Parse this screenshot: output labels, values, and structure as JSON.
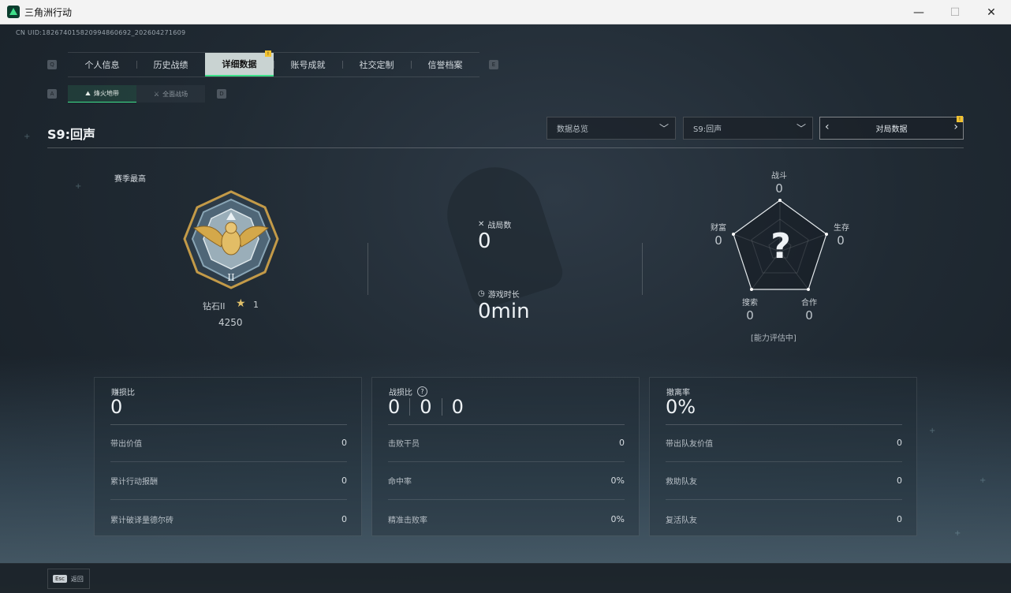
{
  "window": {
    "title": "三角洲行动",
    "minimize": "—",
    "maximize": "☐",
    "close": "✕"
  },
  "uid": "CN UID:1826740158209948606​92_202604271609",
  "tabs": [
    {
      "label": "个人信息"
    },
    {
      "label": "历史战绩"
    },
    {
      "label": "详细数据",
      "active": true
    },
    {
      "label": "账号成就"
    },
    {
      "label": "社交定制"
    },
    {
      "label": "信誉档案"
    }
  ],
  "tab_key_left": "Q",
  "tab_key_right": "E",
  "subtabs": [
    {
      "label": "烽火地带",
      "active": true
    },
    {
      "label": "全面战场"
    }
  ],
  "subtab_key_left": "A",
  "subtab_key_right": "D",
  "season_title": "S9:回声",
  "dropdowns": {
    "overview": "数据总览",
    "season": "S9:回声",
    "match": "对局数据"
  },
  "rank": {
    "header": "赛季最高",
    "name": "钻石II",
    "stars": "1",
    "score": "4250"
  },
  "stats": {
    "matches_label": "战局数",
    "matches_value": "0",
    "time_label": "游戏时长",
    "time_value": "0min"
  },
  "radar": {
    "combat_label": "战斗",
    "combat_value": "0",
    "survive_label": "生存",
    "survive_value": "0",
    "coop_label": "合作",
    "coop_value": "0",
    "search_label": "搜索",
    "search_value": "0",
    "wealth_label": "财富",
    "wealth_value": "0",
    "center": "?",
    "note": "[能力评估中]"
  },
  "panels": {
    "profit": {
      "title": "赚损比",
      "value": "0",
      "rows": [
        {
          "label": "带出价值",
          "value": "0"
        },
        {
          "label": "累计行动报酬",
          "value": "0"
        },
        {
          "label": "累计破译量德尔砖",
          "value": "0"
        }
      ]
    },
    "kd": {
      "title": "战损比",
      "values": [
        "0",
        "0",
        "0"
      ],
      "rows": [
        {
          "label": "击败干员",
          "value": "0"
        },
        {
          "label": "命中率",
          "value": "0%"
        },
        {
          "label": "精准击败率",
          "value": "0%"
        }
      ]
    },
    "extract": {
      "title": "撤离率",
      "value": "0%",
      "rows": [
        {
          "label": "带出队友价值",
          "value": "0"
        },
        {
          "label": "救助队友",
          "value": "0"
        },
        {
          "label": "复活队友",
          "value": "0"
        }
      ]
    }
  },
  "esc": {
    "key": "Esc",
    "label": "返回"
  },
  "colors": {
    "accent": "#3ee08a",
    "notice": "#f2c230",
    "medal_gold": "#d4a84a"
  }
}
